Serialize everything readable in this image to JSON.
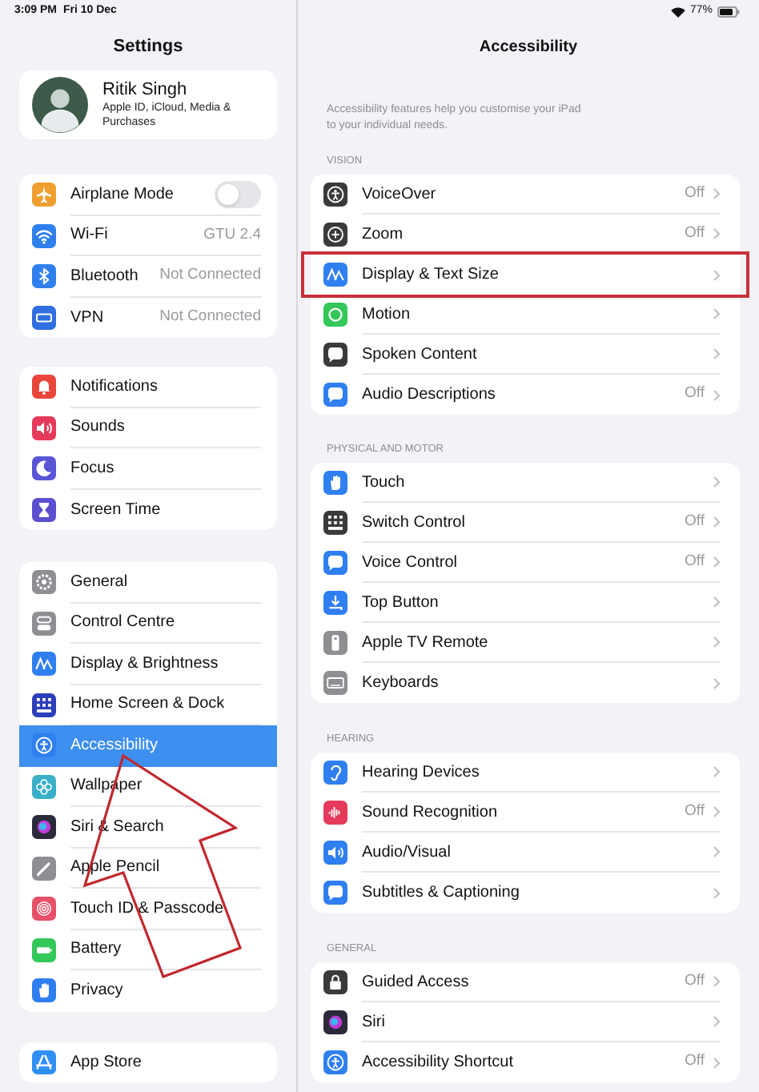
{
  "status_bar": {
    "time": "3:09 PM",
    "date": "Fri 10 Dec",
    "battery": "77%"
  },
  "sidebar": {
    "title": "Settings",
    "profile": {
      "name": "Ritik Singh",
      "subtitle": "Apple ID, iCloud, Media & Purchases"
    },
    "groups": [
      {
        "items": [
          {
            "label": "Airplane Mode",
            "kind": "toggle",
            "on": false,
            "selected": false,
            "color": "#f0a030"
          },
          {
            "label": "Wi-Fi",
            "value": "GTU 2.4",
            "kind": "link",
            "selected": false,
            "color": "#2f80ed"
          },
          {
            "label": "Bluetooth",
            "value": "Not Connected",
            "kind": "link",
            "selected": false,
            "color": "#2f80ed"
          },
          {
            "label": "VPN",
            "value": "Not Connected",
            "kind": "link",
            "selected": false,
            "color": "#2f6fe0"
          }
        ]
      },
      {
        "items": [
          {
            "label": "Notifications",
            "kind": "link",
            "selected": false,
            "color": "#e8463c"
          },
          {
            "label": "Sounds",
            "kind": "link",
            "selected": false,
            "color": "#e63a5a"
          },
          {
            "label": "Focus",
            "kind": "link",
            "selected": false,
            "color": "#5856d6"
          },
          {
            "label": "Screen Time",
            "kind": "link",
            "selected": false,
            "color": "#5a4fcf"
          }
        ]
      },
      {
        "items": [
          {
            "label": "General",
            "kind": "link",
            "selected": false,
            "color": "#8e8e93"
          },
          {
            "label": "Control Centre",
            "kind": "link",
            "selected": false,
            "color": "#8e8e93"
          },
          {
            "label": "Display & Brightness",
            "kind": "link",
            "selected": false,
            "color": "#2f7ff0"
          },
          {
            "label": "Home Screen & Dock",
            "kind": "link",
            "selected": false,
            "color": "#2c3fb8"
          },
          {
            "label": "Accessibility",
            "kind": "link",
            "selected": true,
            "color": "#2f7ff0"
          },
          {
            "label": "Wallpaper",
            "kind": "link",
            "selected": false,
            "color": "#3ab0c8"
          },
          {
            "label": "Siri & Search",
            "kind": "link",
            "selected": false,
            "color": "#2a2a3a"
          },
          {
            "label": "Apple Pencil",
            "kind": "link",
            "selected": false,
            "color": "#8e8e93"
          },
          {
            "label": "Touch ID & Passcode",
            "kind": "link",
            "selected": false,
            "color": "#e8506a"
          },
          {
            "label": "Battery",
            "kind": "link",
            "selected": false,
            "color": "#34c759"
          },
          {
            "label": "Privacy",
            "kind": "link",
            "selected": false,
            "color": "#2f7ff0"
          }
        ]
      },
      {
        "items": [
          {
            "label": "App Store",
            "kind": "link",
            "selected": false,
            "color": "#2f8ff5"
          }
        ]
      }
    ]
  },
  "detail": {
    "title": "Accessibility",
    "description": "Accessibility features help you customise your iPad to your individual needs.",
    "sections": [
      {
        "header": "VISION",
        "items": [
          {
            "label": "VoiceOver",
            "value": "Off",
            "highlighted": false,
            "color": "#3a3a3c"
          },
          {
            "label": "Zoom",
            "value": "Off",
            "highlighted": false,
            "color": "#3a3a3c"
          },
          {
            "label": "Display & Text Size",
            "highlighted": true,
            "color": "#2f7ff0"
          },
          {
            "label": "Motion",
            "highlighted": false,
            "color": "#34c759"
          },
          {
            "label": "Spoken Content",
            "highlighted": false,
            "color": "#3a3a3c"
          },
          {
            "label": "Audio Descriptions",
            "value": "Off",
            "highlighted": false,
            "color": "#2f7ff0"
          }
        ]
      },
      {
        "header": "PHYSICAL AND MOTOR",
        "items": [
          {
            "label": "Touch",
            "highlighted": false,
            "color": "#2f7ff0"
          },
          {
            "label": "Switch Control",
            "value": "Off",
            "highlighted": false,
            "color": "#3a3a3c"
          },
          {
            "label": "Voice Control",
            "value": "Off",
            "highlighted": false,
            "color": "#2f7ff0"
          },
          {
            "label": "Top Button",
            "highlighted": false,
            "color": "#2f7ff0"
          },
          {
            "label": "Apple TV Remote",
            "highlighted": false,
            "color": "#8e8e93"
          },
          {
            "label": "Keyboards",
            "highlighted": false,
            "color": "#8e8e93"
          }
        ]
      },
      {
        "header": "HEARING",
        "items": [
          {
            "label": "Hearing Devices",
            "highlighted": false,
            "color": "#2f7ff0"
          },
          {
            "label": "Sound Recognition",
            "value": "Off",
            "highlighted": false,
            "color": "#e63a5a"
          },
          {
            "label": "Audio/Visual",
            "highlighted": false,
            "color": "#2f7ff0"
          },
          {
            "label": "Subtitles & Captioning",
            "highlighted": false,
            "color": "#2f7ff0"
          }
        ]
      },
      {
        "header": "GENERAL",
        "items": [
          {
            "label": "Guided Access",
            "value": "Off",
            "highlighted": false,
            "color": "#3a3a3c"
          },
          {
            "label": "Siri",
            "highlighted": false,
            "color": "#2a2a3a"
          },
          {
            "label": "Accessibility Shortcut",
            "value": "Off",
            "highlighted": false,
            "color": "#2f7ff0"
          }
        ]
      }
    ]
  },
  "arrow_annotation": true
}
